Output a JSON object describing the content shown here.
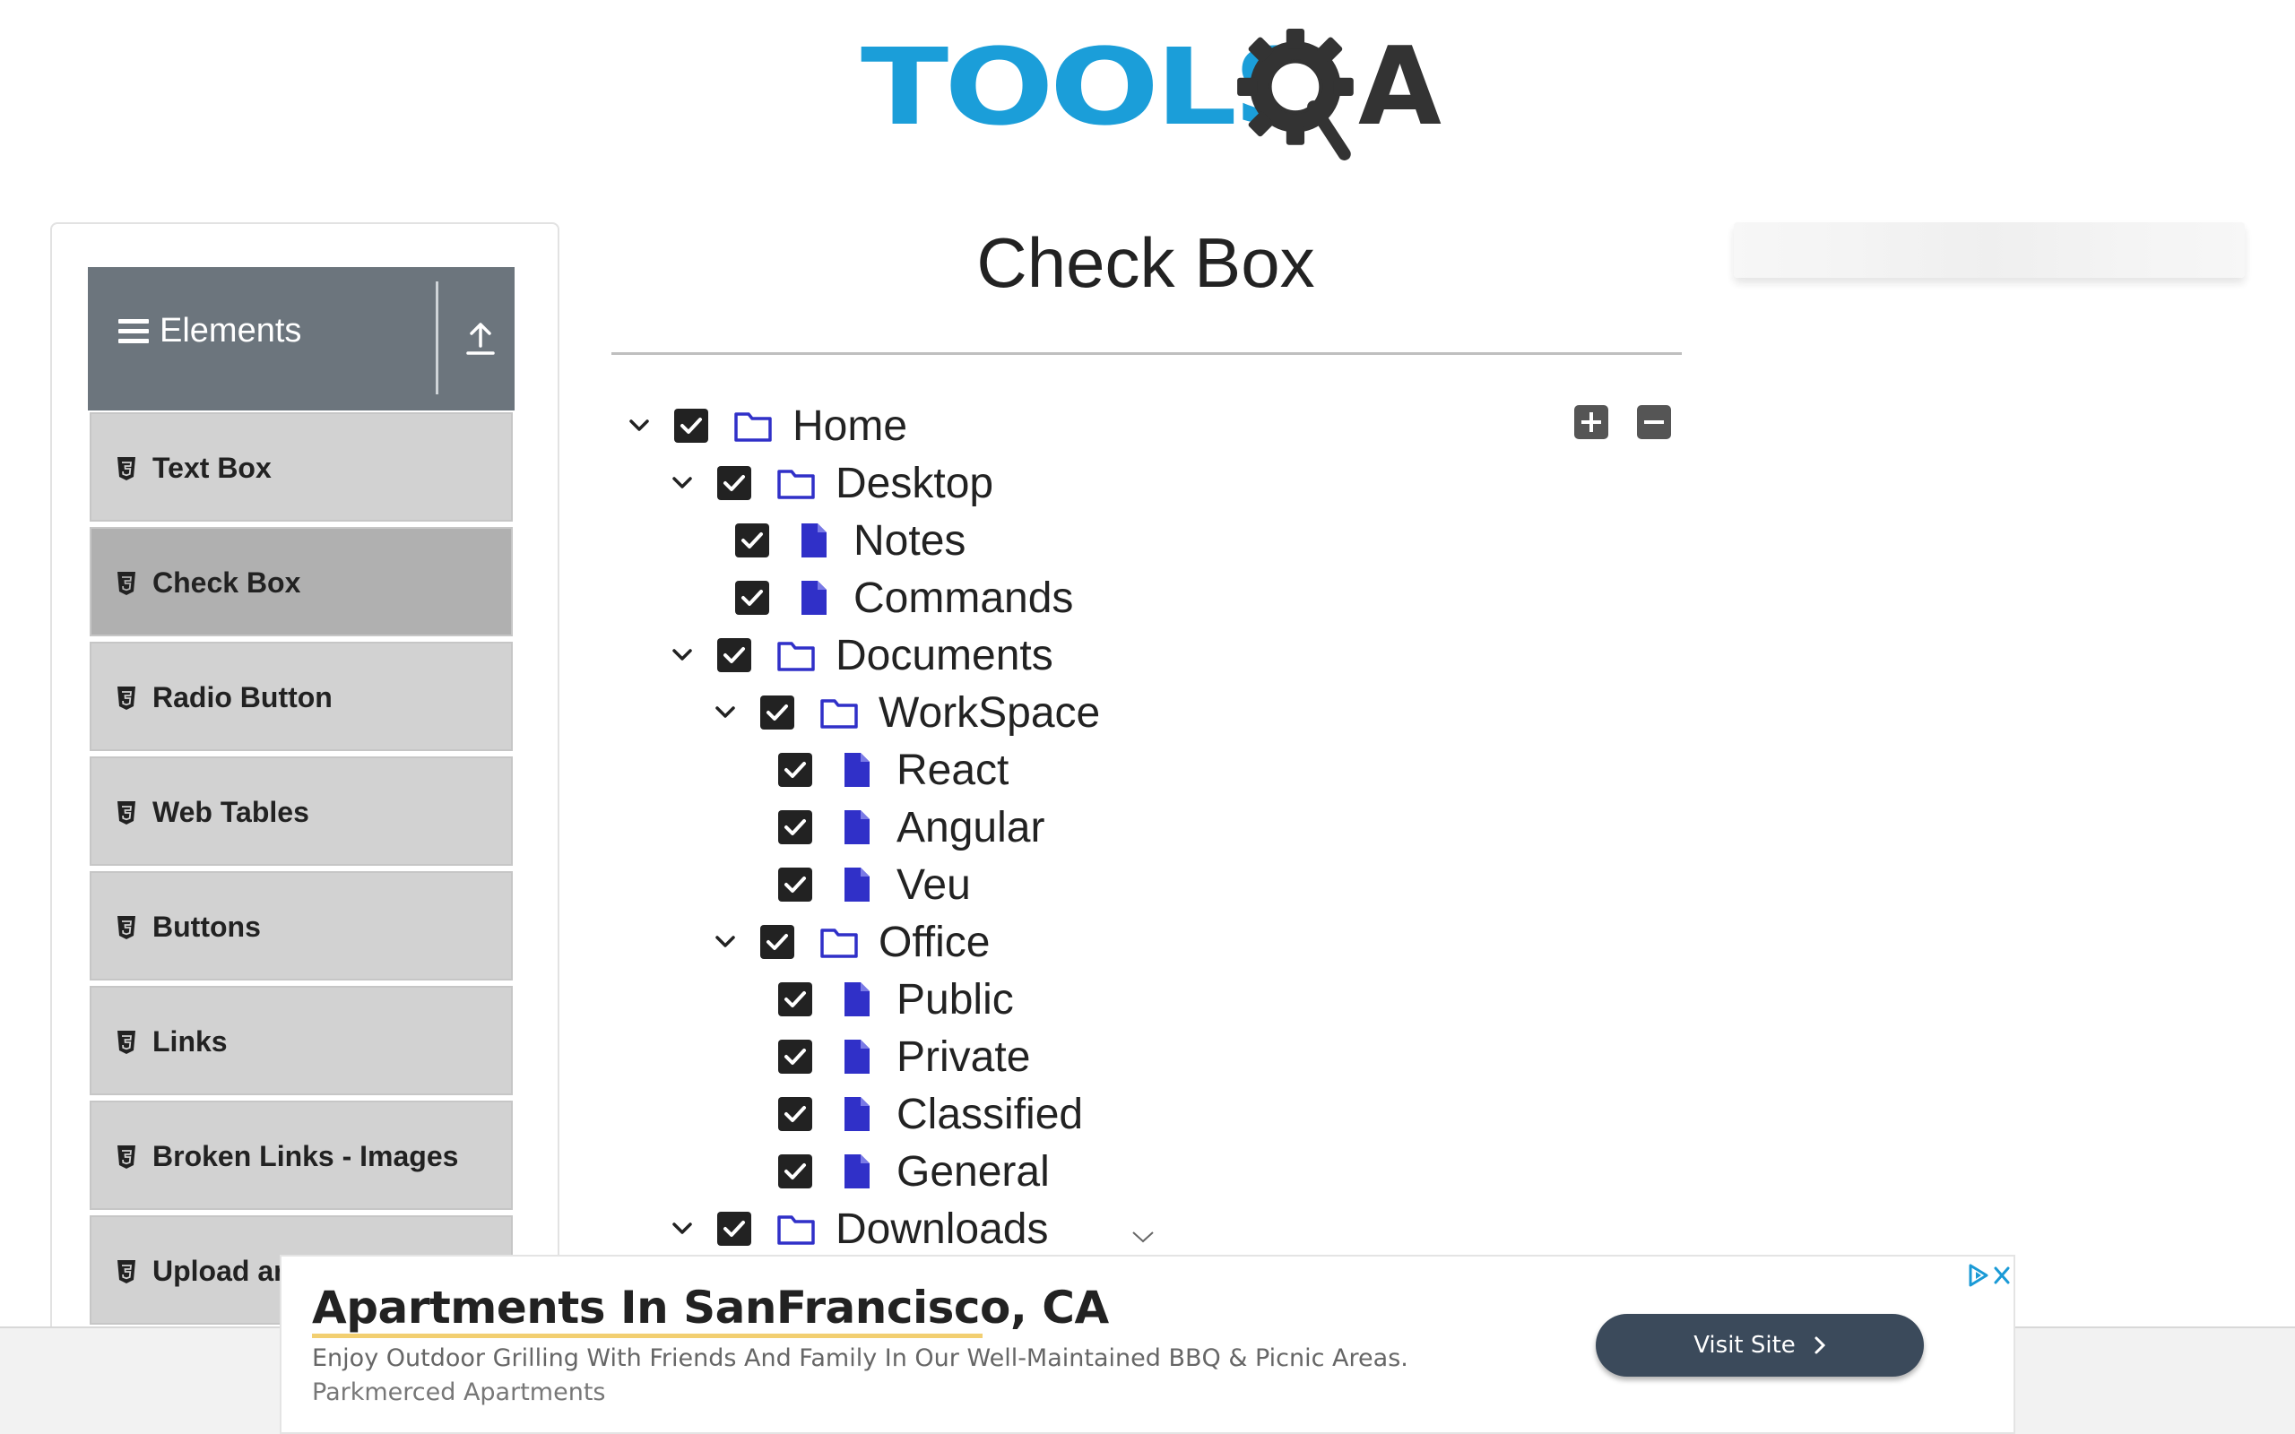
{
  "header": {
    "logo_text_tools": "TOOLS",
    "logo_text_a": "A",
    "brand_colors": {
      "tools": "#1b9ed9",
      "qa": "#333333"
    }
  },
  "sidebar": {
    "group_title": "Elements",
    "group_icons": {
      "menu": "hamburger-icon",
      "collapse": "upload-arrow-icon"
    },
    "items": [
      {
        "label": "Text Box",
        "active": false
      },
      {
        "label": "Check Box",
        "active": true
      },
      {
        "label": "Radio Button",
        "active": false
      },
      {
        "label": "Web Tables",
        "active": false
      },
      {
        "label": "Buttons",
        "active": false
      },
      {
        "label": "Links",
        "active": false
      },
      {
        "label": "Broken Links - Images",
        "active": false
      },
      {
        "label": "Upload ar",
        "active": false
      }
    ]
  },
  "main": {
    "title": "Check Box",
    "tree_controls": {
      "expand_all": "plus-square-icon",
      "collapse_all": "minus-square-icon"
    },
    "tree": [
      {
        "label": "Home",
        "type": "folder",
        "level": 0,
        "checked": true,
        "expanded": true
      },
      {
        "label": "Desktop",
        "type": "folder",
        "level": 1,
        "checked": true,
        "expanded": true
      },
      {
        "label": "Notes",
        "type": "file",
        "level": 2,
        "checked": true
      },
      {
        "label": "Commands",
        "type": "file",
        "level": 2,
        "checked": true
      },
      {
        "label": "Documents",
        "type": "folder",
        "level": 1,
        "checked": true,
        "expanded": true
      },
      {
        "label": "WorkSpace",
        "type": "folder",
        "level": 2,
        "checked": true,
        "expanded": true
      },
      {
        "label": "React",
        "type": "file",
        "level": 3,
        "checked": true
      },
      {
        "label": "Angular",
        "type": "file",
        "level": 3,
        "checked": true
      },
      {
        "label": "Veu",
        "type": "file",
        "level": 3,
        "checked": true
      },
      {
        "label": "Office",
        "type": "folder",
        "level": 2,
        "checked": true,
        "expanded": true
      },
      {
        "label": "Public",
        "type": "file",
        "level": 3,
        "checked": true
      },
      {
        "label": "Private",
        "type": "file",
        "level": 3,
        "checked": true
      },
      {
        "label": "Classified",
        "type": "file",
        "level": 3,
        "checked": true
      },
      {
        "label": "General",
        "type": "file",
        "level": 3,
        "checked": true
      },
      {
        "label": "Downloads",
        "type": "folder",
        "level": 1,
        "checked": true,
        "expanded": true
      }
    ],
    "icon_color": "#3030c8"
  },
  "ad": {
    "headline": "Apartments In SanFrancisco, CA",
    "body": "Enjoy Outdoor Grilling With Friends And Family In Our Well-Maintained BBQ & Picnic Areas.",
    "sponsor": "Parkmerced Apartments",
    "cta": "Visit Site"
  }
}
